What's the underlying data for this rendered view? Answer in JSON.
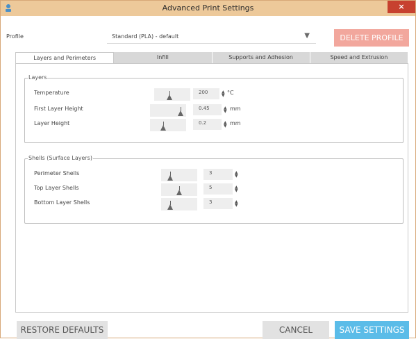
{
  "window": {
    "title": "Advanced Print Settings",
    "close_label": "×"
  },
  "profile": {
    "label": "Profile",
    "selected": "Standard (PLA)  -  default",
    "delete_label": "DELETE PROFILE"
  },
  "tabs": [
    {
      "label": "Layers and Perimeters",
      "active": true
    },
    {
      "label": "Infill",
      "active": false
    },
    {
      "label": "Supports and Adhesion",
      "active": false
    },
    {
      "label": "Speed and Extrusion",
      "active": false
    }
  ],
  "layers_group": {
    "legend": "Layers",
    "rows": [
      {
        "label": "Temperature",
        "value": "200",
        "unit": "°C",
        "slider_fraction": 0.4
      },
      {
        "label": "First Layer Height",
        "value": "0.45",
        "unit": "mm",
        "slider_fraction": 0.9
      },
      {
        "label": "Layer Height",
        "value": "0.2",
        "unit": "mm",
        "slider_fraction": 0.35
      }
    ]
  },
  "shells_group": {
    "legend": "Shells (Surface Layers)",
    "rows": [
      {
        "label": "Perimeter Shells",
        "value": "3",
        "slider_fraction": 0.2
      },
      {
        "label": "Top Layer Shells",
        "value": "5",
        "slider_fraction": 0.5
      },
      {
        "label": "Bottom Layer Shells",
        "value": "3",
        "slider_fraction": 0.2
      }
    ]
  },
  "footer": {
    "restore_label": "RESTORE DEFAULTS",
    "cancel_label": "CANCEL",
    "save_label": "SAVE SETTINGS"
  },
  "colors": {
    "titlebar": "#edc99a",
    "close": "#c7412f",
    "delete": "#f2a79d",
    "save": "#5bbce8"
  }
}
